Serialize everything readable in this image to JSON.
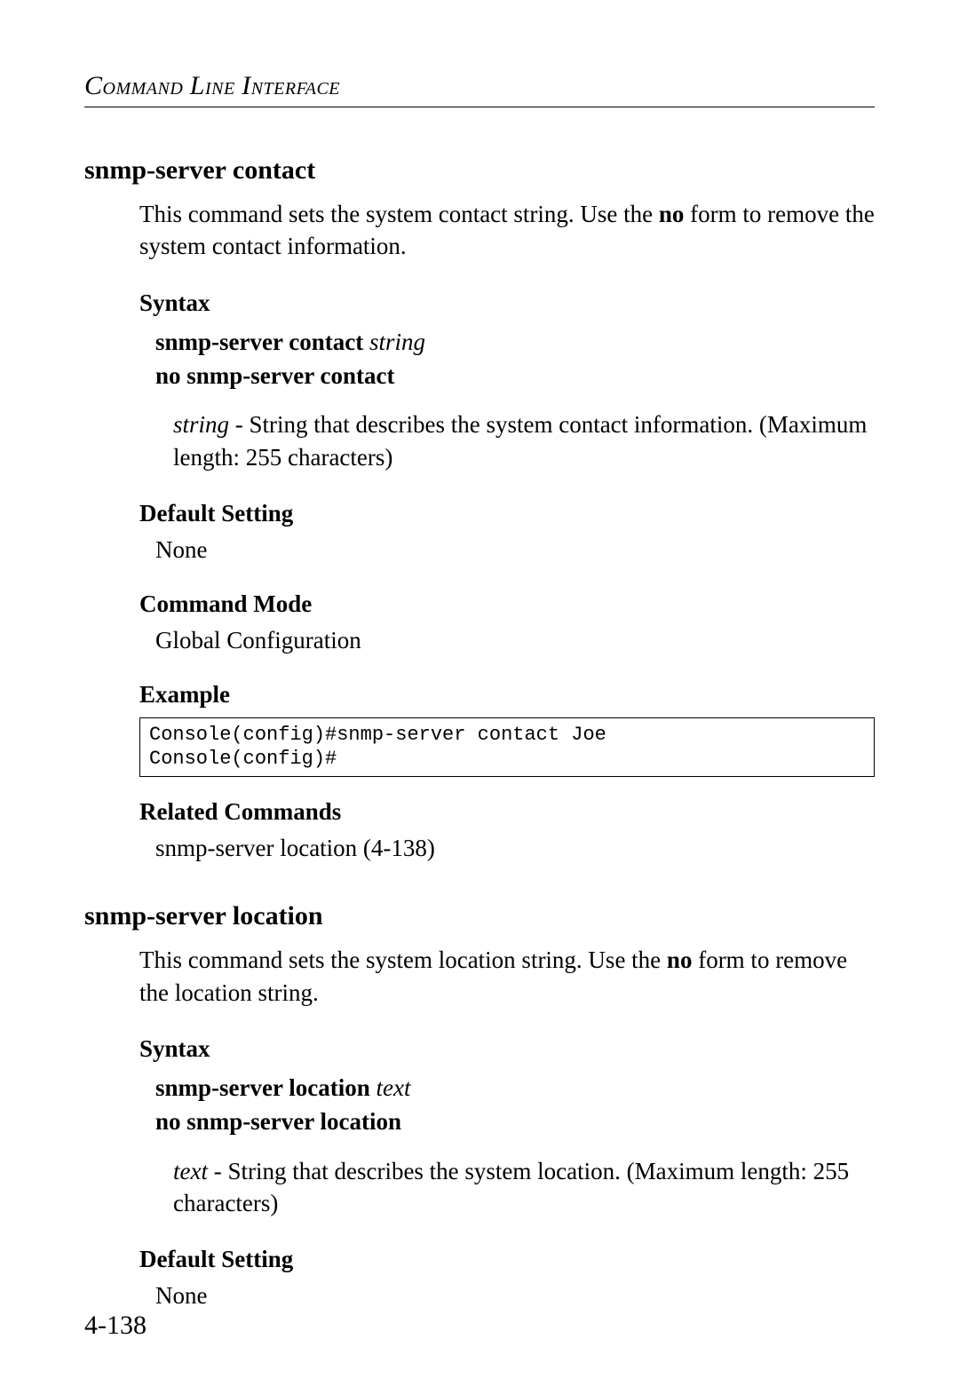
{
  "header": {
    "running_title": "Command Line Interface"
  },
  "sections": [
    {
      "title": "snmp-server contact",
      "intro_pre": "This command sets the system contact string. Use the ",
      "intro_bold": "no",
      "intro_post": " form to remove the system contact information.",
      "syntax_label": "Syntax",
      "syntax_cmd_bold": "snmp-server contact",
      "syntax_cmd_ital": "string",
      "syntax_no": "no snmp-server contact",
      "param_ital": "string",
      "param_rest": " - String that describes the system contact information. (Maximum length: 255 characters)",
      "default_label": "Default Setting",
      "default_value": "None",
      "mode_label": "Command Mode",
      "mode_value": "Global Configuration",
      "example_label": "Example",
      "example_text": "Console(config)#snmp-server contact Joe\nConsole(config)#",
      "related_label": "Related Commands",
      "related_value": "snmp-server location (4-138)"
    },
    {
      "title": "snmp-server location",
      "intro_pre": "This command sets the system location string. Use the ",
      "intro_bold": "no",
      "intro_post": " form to remove the location string.",
      "syntax_label": "Syntax",
      "syntax_cmd_bold": "snmp-server location",
      "syntax_cmd_ital": "text",
      "syntax_no": "no snmp-server location",
      "param_ital": "text",
      "param_rest": " - String that describes the system location. (Maximum length: 255 characters)",
      "default_label": "Default Setting",
      "default_value": "None"
    }
  ],
  "page_number": "4-138"
}
